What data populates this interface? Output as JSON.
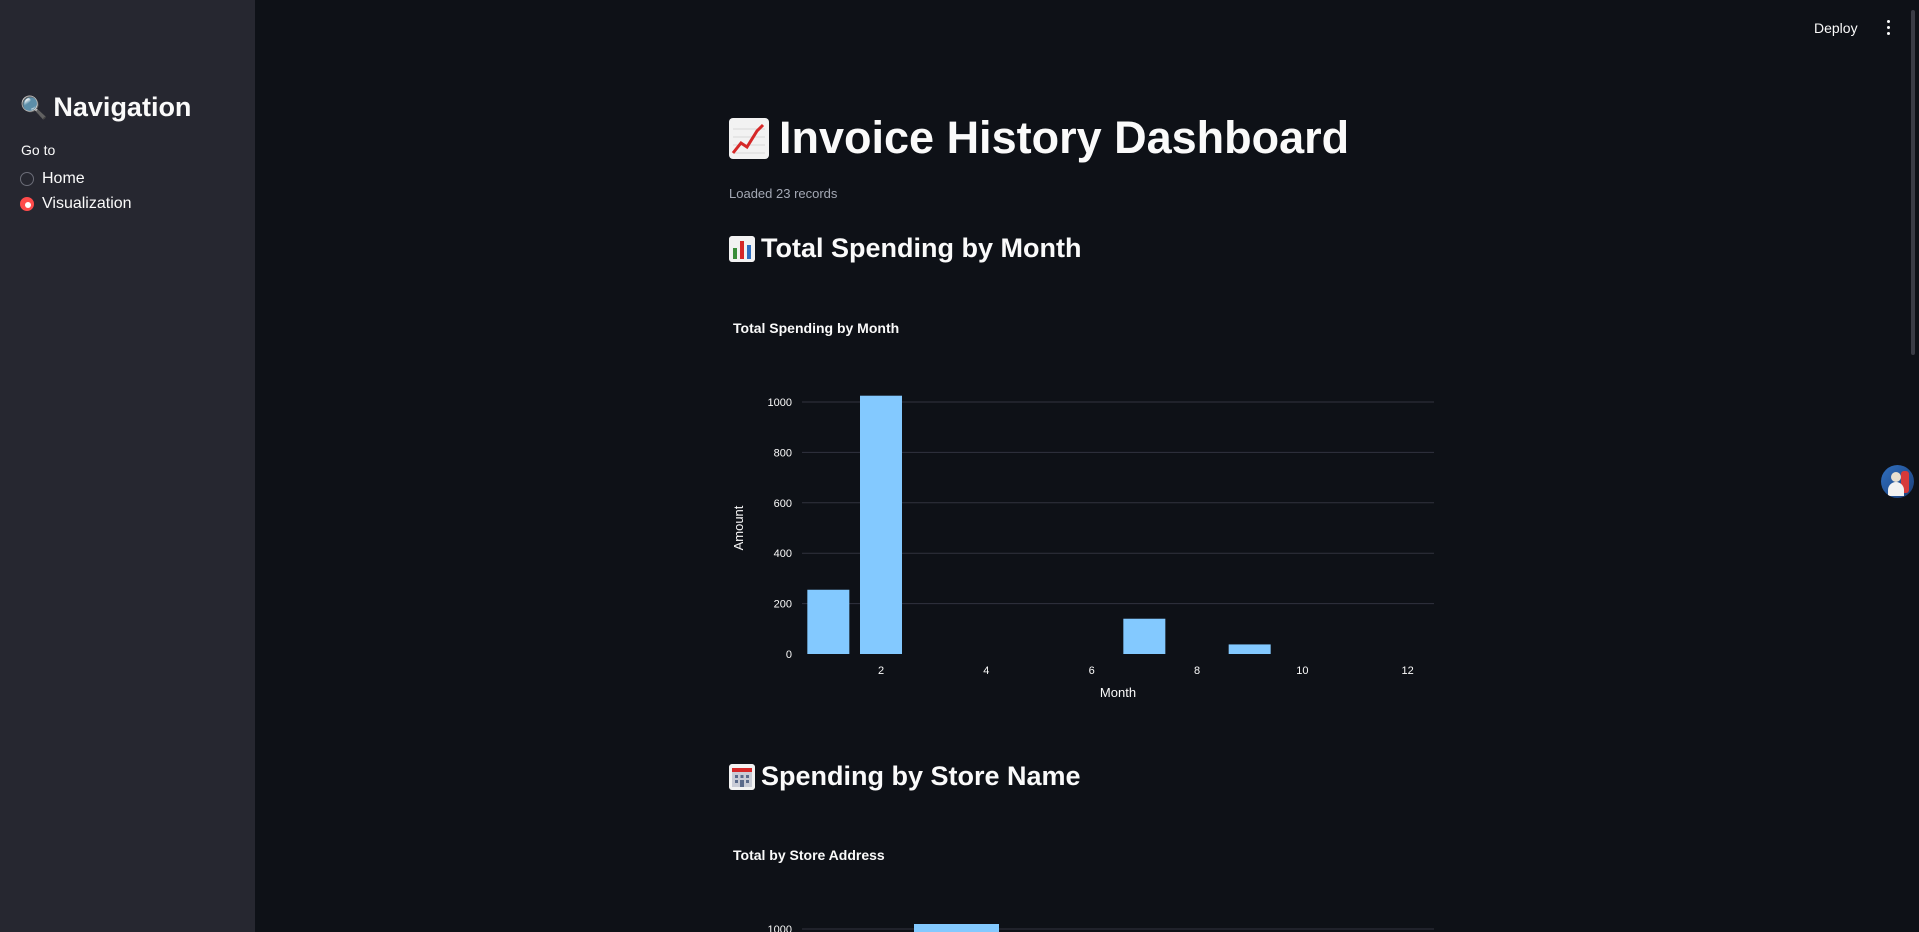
{
  "sidebar": {
    "title": "Navigation",
    "title_icon": "magnifier-icon",
    "radio_label": "Go to",
    "options": [
      {
        "label": "Home",
        "selected": false
      },
      {
        "label": "Visualization",
        "selected": true
      }
    ],
    "accent_color": "#ff4b4b"
  },
  "toolbar": {
    "deploy_label": "Deploy",
    "menu_icon": "vertical-dots-icon"
  },
  "main": {
    "title": "Invoice History Dashboard",
    "title_icon": "chart-increasing-icon",
    "records_text": "Loaded 23 records",
    "sections": [
      {
        "heading": "Total Spending by Month",
        "icon": "bar-chart-icon"
      },
      {
        "heading": "Spending by Store Name",
        "icon": "department-store-icon"
      }
    ]
  },
  "chart_data": [
    {
      "type": "bar",
      "title": "Total Spending by Month",
      "xlabel": "Month",
      "ylabel": "Amount",
      "x": [
        1,
        2,
        7,
        9
      ],
      "values": [
        255,
        1025,
        140,
        38
      ],
      "xlim": [
        0.5,
        12.5
      ],
      "ylim": [
        0,
        1000
      ],
      "xticks": [
        "2",
        "4",
        "6",
        "8",
        "10",
        "12"
      ],
      "yticks": [
        "0",
        "200",
        "400",
        "600",
        "800",
        "1000"
      ],
      "grid": true,
      "bar_color": "#83c9ff"
    },
    {
      "type": "bar",
      "title": "Total by Store Address",
      "yticks": [
        "1000"
      ],
      "bar_color": "#83c9ff"
    }
  ]
}
